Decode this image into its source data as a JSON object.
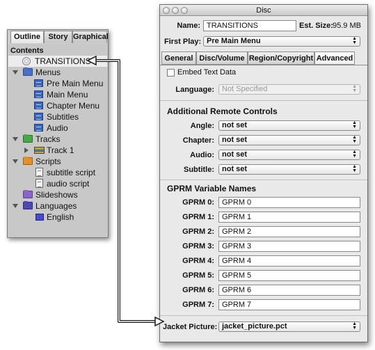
{
  "outline": {
    "tabs": [
      "Outline",
      "Story",
      "Graphical"
    ],
    "active_tab": "Outline",
    "contents_header": "Contents",
    "items": {
      "root": "TRANSITIONS",
      "menus": "Menus",
      "pre_main_menu": "Pre Main Menu",
      "main_menu": "Main Menu",
      "chapter_menu": "Chapter Menu",
      "subtitles": "Subtitles",
      "audio": "Audio",
      "tracks": "Tracks",
      "track_1": "Track 1",
      "scripts": "Scripts",
      "subtitle_script": "subtitle script",
      "audio_script": "audio script",
      "slideshows": "Slideshows",
      "languages": "Languages",
      "english": "English"
    }
  },
  "disc": {
    "window_title": "Disc",
    "name_label": "Name:",
    "name_value": "TRANSITIONS",
    "est_size_label": "Est. Size:",
    "est_size_value": "95.9 MB",
    "first_play_label": "First Play:",
    "first_play_value": "Pre Main Menu",
    "tabs": [
      "General",
      "Disc/Volume",
      "Region/Copyright",
      "Advanced"
    ],
    "active_tab": "Advanced",
    "embed_text_label": "Embed Text Data",
    "language_label": "Language:",
    "language_value": "Not Specified",
    "remote_header": "Additional Remote Controls",
    "angle_label": "Angle:",
    "angle_value": "not set",
    "chapter_label": "Chapter:",
    "chapter_value": "not set",
    "audio_label": "Audio:",
    "audio_value": "not set",
    "subtitle_label": "Subtitle:",
    "subtitle_value": "not set",
    "gprm_header": "GPRM Variable Names",
    "gprm": [
      {
        "label": "GPRM 0:",
        "value": "GPRM 0"
      },
      {
        "label": "GPRM 1:",
        "value": "GPRM 1"
      },
      {
        "label": "GPRM 2:",
        "value": "GPRM 2"
      },
      {
        "label": "GPRM 3:",
        "value": "GPRM 3"
      },
      {
        "label": "GPRM 4:",
        "value": "GPRM 4"
      },
      {
        "label": "GPRM 5:",
        "value": "GPRM 5"
      },
      {
        "label": "GPRM 6:",
        "value": "GPRM 6"
      },
      {
        "label": "GPRM 7:",
        "value": "GPRM 7"
      }
    ],
    "jacket_label": "Jacket Picture:",
    "jacket_value": "jacket_picture.pct"
  }
}
